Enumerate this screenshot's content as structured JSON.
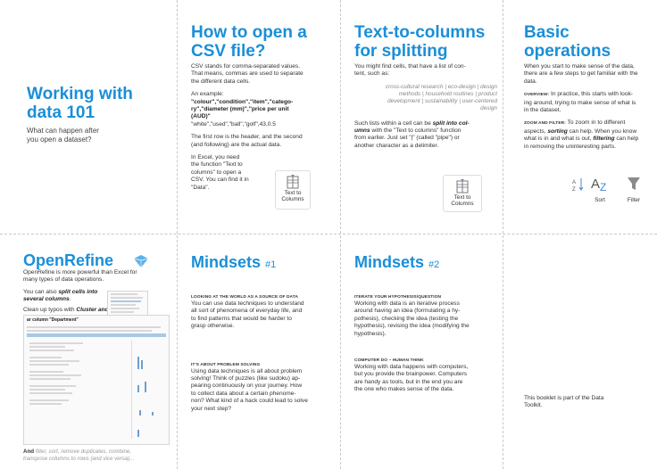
{
  "col1": {
    "title_line1": "Working with",
    "title_line2": "data 101",
    "subtitle_line1": "What can happen after",
    "subtitle_line2": "you open a dataset?"
  },
  "col2": {
    "title_line1": "How to open a",
    "title_line2": "CSV file?",
    "para1_line1": "CSV stands for comma-separated values.",
    "para1_line2": "That means, commas are used to separate",
    "para1_line3": "the different data cells.",
    "example_label": "An example:",
    "example_line1": "\"colour\",\"condition\",\"item\",\"catego-",
    "example_line2": "ry\",\"diameter (mm)\",\"price per unit",
    "example_line3": "(AUD)\"",
    "example_line4": "\"white\",\"used\",\"ball\",\"golf\",43,0.5",
    "para2_line1": "The first row is the header, and the second",
    "para2_line2": "(and following) are the actual data.",
    "para3_line1": "In Excel, you need",
    "para3_line2": "the function \"Text to",
    "para3_line3": "columns\" to open a",
    "para3_line4": "CSV.  You can find it in",
    "para3_line5": "\"Data\".",
    "button_line1": "Text to",
    "button_line2": "Columns"
  },
  "col3": {
    "title_line1": "Text-to-columns",
    "title_line2": "for splitting",
    "para1_line1": "You might find cells, that have a list of con-",
    "para1_line2": "tent, such as:",
    "ital_line1": "cross-cultural research | eco-design | design",
    "ital_line2": "methods | household routines | product",
    "ital_line3": "development | sustainability | user-centered",
    "ital_line4": "design",
    "para2_line1a": "Such lists within a cell can be ",
    "para2_line1b": "split into col-",
    "para2_line2a": "umns",
    "para2_line2b": " with the \"Text to columns\" function",
    "para2_line3": "from earlier. Just set \"|\" (called \"pipe\") or",
    "para2_line4": "another character as a delimiter.",
    "button_line1": "Text to",
    "button_line2": "Columns"
  },
  "col4": {
    "title_line1": "Basic",
    "title_line2": "operations",
    "para1_line1": "When you start to make sense of the data,",
    "para1_line2": "there are a few steps to get familiar with the",
    "para1_line3": "data.",
    "overview_label": "OVERVIEW:",
    "overview_line1": " In practice, this starts with look-",
    "overview_line2": "ing around, trying to make sense of what is",
    "overview_line3": "in the dataset.",
    "zoom_label": "ZOOM AND FILTER:",
    "zoom_line1": " To zoom in to different",
    "zoom_line2a": "aspects, ",
    "zoom_line2b": "sorting",
    "zoom_line2c": " can help. When you know",
    "zoom_line3a": "what is in and what is out, ",
    "zoom_line3b": "filtering",
    "zoom_line3c": " can help",
    "zoom_line4": "in removing the uninteresting parts.",
    "sort_label": "Sort",
    "filter_label": "Filter"
  },
  "row2col1": {
    "title": "OpenRefine",
    "intro_line1": "OpenRefine is more powerful than Excel for",
    "intro_line2": "many types of data operations.",
    "split_line1a": "You can also ",
    "split_line1b": "split cells into",
    "split_line2": "several columns",
    "split_line2end": ".",
    "cleanup_a": "Clean up typos with ",
    "cleanup_b": "Cluster and edit",
    "cleanup_c": ".",
    "ss_title": "ar column \"Department\"",
    "more_a": "And ",
    "more_b": "filter, sort, remove duplicates, combine,",
    "more_line2": "transpose columns to rows (and vice versa)..."
  },
  "row2col2": {
    "title": "Mindsets",
    "num": "#1",
    "h1": "LOOKING AT THE WORLD AS A SOURCE OF DATA",
    "p1_line1": "You can use data techniques to understand",
    "p1_line2": "all sort of phenomena of everyday life, and",
    "p1_line3": "to find patterns that would be harder to",
    "p1_line4": "grasp otherwise.",
    "h2": "IT'S ABOUT PROBLEM SOLVING",
    "p2_line1": "Using data techniques is all about problem",
    "p2_line2": "solving! Think of puzzles (like sudoku) ap-",
    "p2_line3": "pearing continuously on your journey. How",
    "p2_line4": "to collect data about a certain phenome-",
    "p2_line5": "non? What kind of a hack could lead to solve",
    "p2_line6": "your next step?"
  },
  "row2col3": {
    "title": "Mindsets",
    "num": "#2",
    "h1": "ITERATE YOUR HYPOTHESIS/QUESTION",
    "p1_line1": "Working with data is an iterative process",
    "p1_line2": "around having an idea (formulating a hy-",
    "p1_line3": "pothesis), checking the idea (testing the",
    "p1_line4": "hypothesis), revising the idea (modifying the",
    "p1_line5": "hypothesis).",
    "h2": "COMPUTER DO – HUMAN THINK",
    "p2_line1": "Working with data happens with computers,",
    "p2_line2": "but you provide the brainpower. Computers",
    "p2_line3": "are handy as tools, but in the end you are",
    "p2_line4": "the one who makes sense of the data."
  },
  "row2col4": {
    "note_line1": "This booklet is part of the Data",
    "note_line2": "Toolkit."
  },
  "colors": {
    "accent": "#1a8fd8",
    "divider": "#c8c8c8"
  }
}
